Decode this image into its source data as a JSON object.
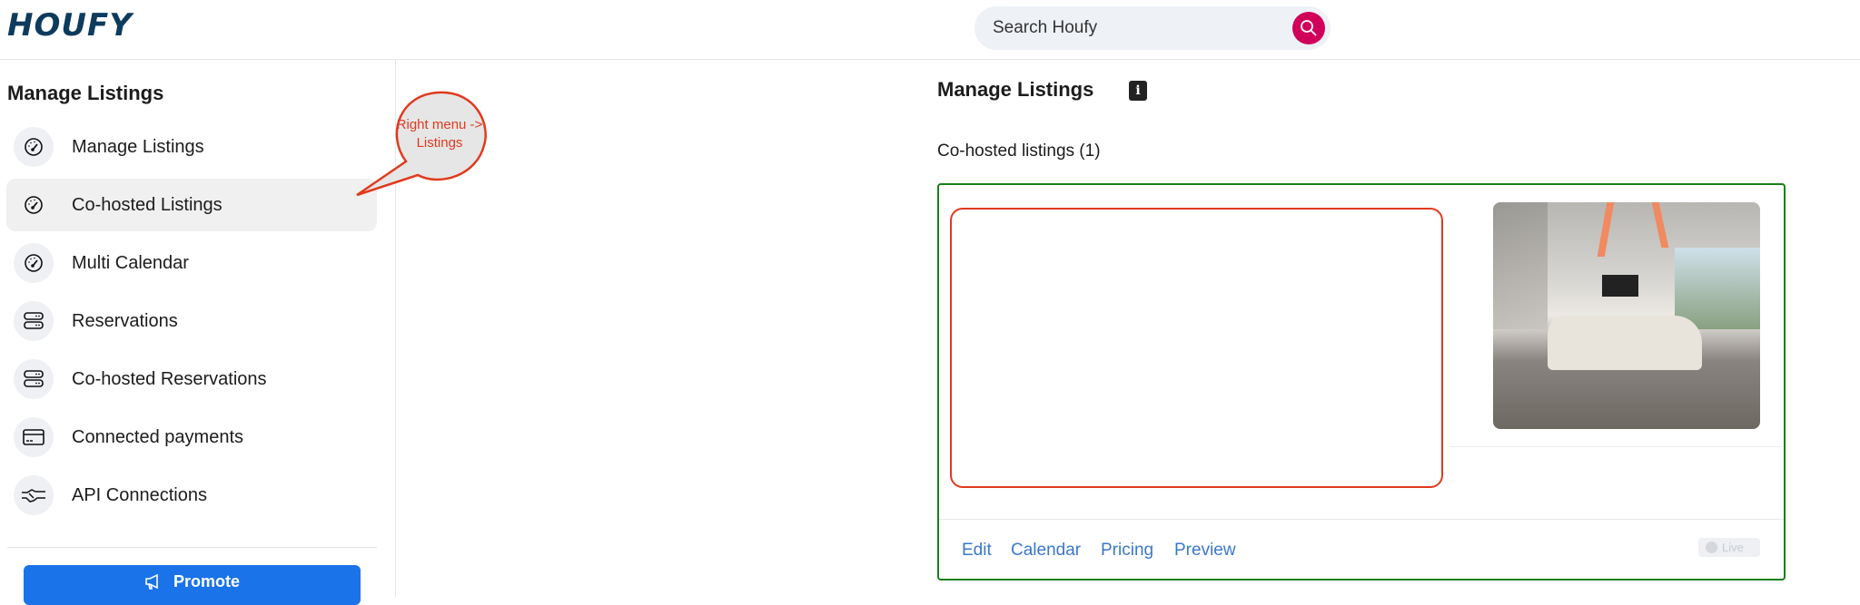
{
  "header": {
    "logo": "HOUFY",
    "search_placeholder": "Search Houfy"
  },
  "sidebar": {
    "title": "Manage Listings",
    "items": [
      {
        "label": "Manage Listings",
        "icon": "gauge-icon"
      },
      {
        "label": "Co-hosted Listings",
        "icon": "gauge-icon",
        "active": true
      },
      {
        "label": "Multi Calendar",
        "icon": "gauge-icon"
      },
      {
        "label": "Reservations",
        "icon": "server-icon"
      },
      {
        "label": "Co-hosted Reservations",
        "icon": "server-icon"
      },
      {
        "label": "Connected payments",
        "icon": "credit-card-icon"
      },
      {
        "label": "API Connections",
        "icon": "handshake-icon"
      }
    ],
    "promote_label": "Promote"
  },
  "annotation": {
    "callout": "Right menu -> Listings"
  },
  "main": {
    "title": "Manage Listings",
    "subtitle": "Co-hosted listings (1)",
    "card": {
      "actions": [
        "Edit",
        "Calendar",
        "Pricing",
        "Preview"
      ],
      "status": "Live"
    }
  },
  "colors": {
    "brand": "#0d3b5e",
    "search_button": "#d1005a",
    "promote": "#1a73e8",
    "link": "#3a78c9",
    "card_border": "#1a7f1a",
    "annotation": "#e03a1e"
  }
}
